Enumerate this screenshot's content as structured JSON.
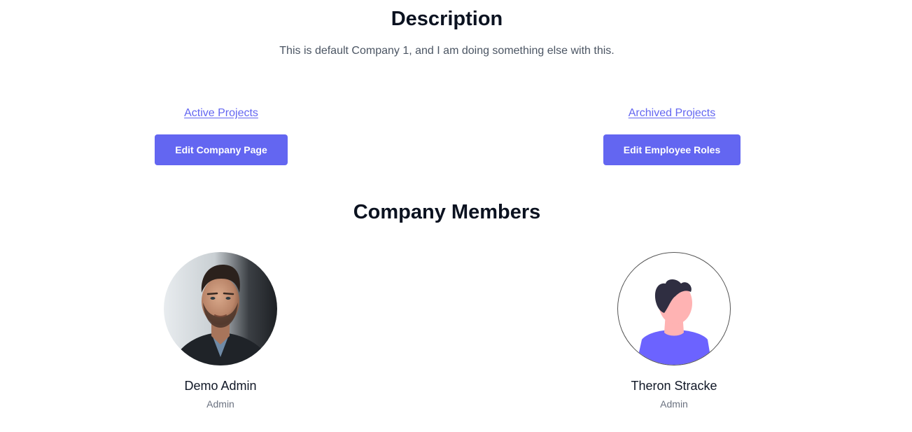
{
  "description": {
    "title": "Description",
    "text": "This is default Company 1, and I am doing something else with this."
  },
  "links": {
    "active_projects": "Active Projects",
    "archived_projects": "Archived Projects"
  },
  "buttons": {
    "edit_company_page": "Edit Company Page",
    "edit_employee_roles": "Edit Employee Roles"
  },
  "members": {
    "title": "Company Members",
    "items": [
      {
        "name": "Demo Admin",
        "role": "Admin",
        "avatar": "photo-avatar"
      },
      {
        "name": "Theron Stracke",
        "role": "Admin",
        "avatar": "default-person-avatar"
      }
    ]
  },
  "colors": {
    "accent": "#6366f1",
    "heading": "#0b1220",
    "muted": "#6b7280"
  }
}
